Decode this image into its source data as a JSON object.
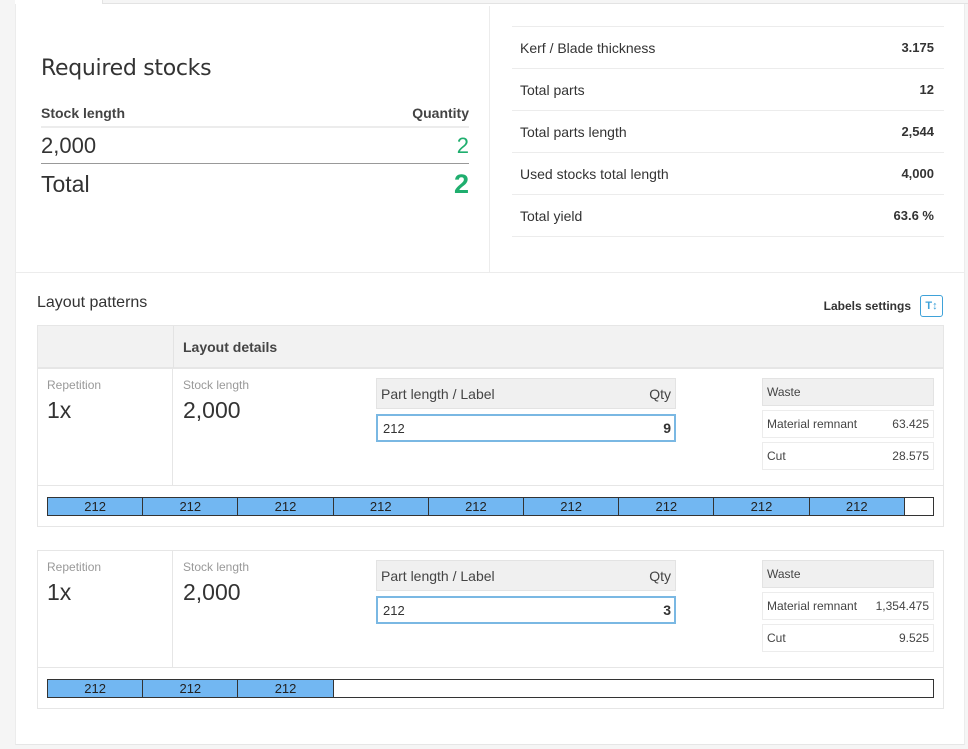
{
  "required_stocks": {
    "title": "Required stocks",
    "col_stock_length": "Stock length",
    "col_quantity": "Quantity",
    "rows": [
      {
        "length": "2,000",
        "quantity": "2"
      }
    ],
    "total_label": "Total",
    "total_value": "2"
  },
  "summary": [
    {
      "label": "Kerf / Blade thickness",
      "value": "3.175"
    },
    {
      "label": "Total parts",
      "value": "12"
    },
    {
      "label": "Total parts length",
      "value": "2,544"
    },
    {
      "label": "Used stocks total length",
      "value": "4,000"
    },
    {
      "label": "Total yield",
      "value": "63.6 %"
    }
  ],
  "layout": {
    "title": "Layout patterns",
    "labels_settings": "Labels settings",
    "labels_settings_icon": "text-height-icon",
    "labels_settings_glyph": "T↕",
    "details_header": "Layout details",
    "repetition_label": "Repetition",
    "stock_length_label": "Stock length",
    "parts_header_label": "Part length / Label",
    "parts_header_qty": "Qty",
    "waste_header": "Waste",
    "material_remnant_label": "Material remnant",
    "cut_label": "Cut",
    "patterns": [
      {
        "repetition": "1x",
        "stock_length": "2,000",
        "part_length": "212",
        "part_qty": "9",
        "material_remnant": "63.425",
        "cut": "28.575",
        "used_fraction": 0.9682,
        "segments": [
          "212",
          "212",
          "212",
          "212",
          "212",
          "212",
          "212",
          "212",
          "212"
        ]
      },
      {
        "repetition": "1x",
        "stock_length": "2,000",
        "part_length": "212",
        "part_qty": "3",
        "material_remnant": "1,354.475",
        "cut": "9.525",
        "used_fraction": 0.3228,
        "segments": [
          "212",
          "212",
          "212"
        ]
      }
    ]
  },
  "colors": {
    "green": "#1fae6e",
    "blue_segment": "#72b7f2",
    "accent": "#3fa2d9"
  }
}
